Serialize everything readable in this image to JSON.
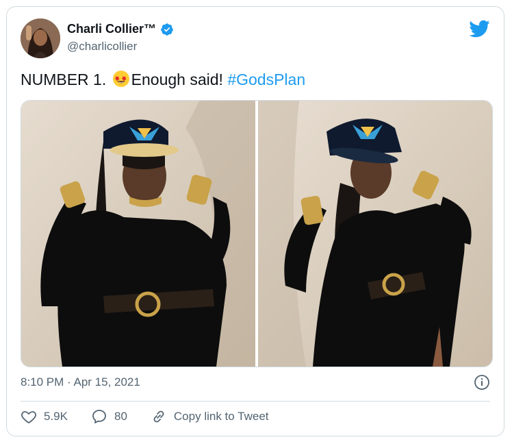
{
  "tweet": {
    "author_name": "Charli Collier™",
    "author_handle": "@charlicollier",
    "text_before_emoji": "NUMBER 1. ",
    "emoji": "star-struck",
    "text_after_emoji": "Enough said! ",
    "hashtag": "#GodsPlan",
    "timestamp": "8:10 PM · Apr 15, 2021"
  },
  "actions": {
    "likes": "5.9K",
    "replies": "80",
    "copy_link_label": "Copy link to Tweet"
  },
  "colors": {
    "accent": "#1d9bf0",
    "text": "#0f1419",
    "muted": "#536471",
    "border": "#cfd9de"
  },
  "icons": {
    "logo": "twitter-bird-icon",
    "verified": "verified-badge-icon",
    "info": "info-icon",
    "like": "heart-icon",
    "reply": "speech-bubble-icon",
    "link": "link-icon"
  }
}
